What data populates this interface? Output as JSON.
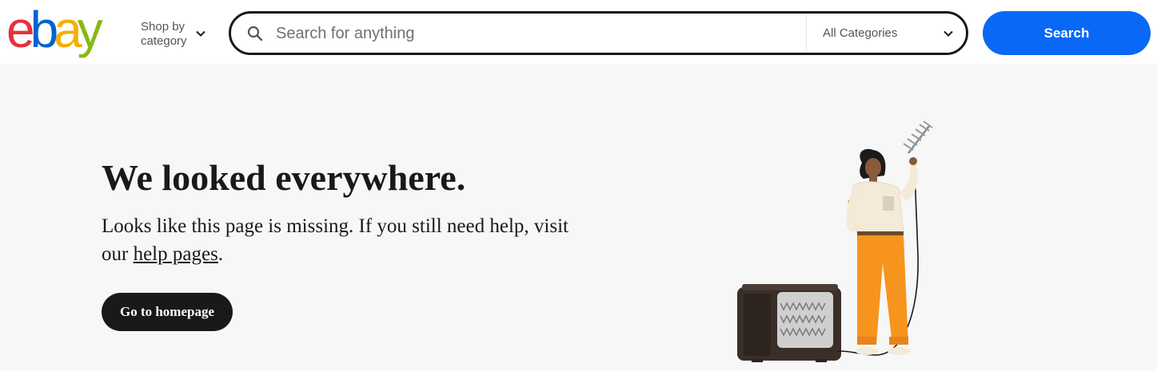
{
  "header": {
    "logo": {
      "letters": [
        "e",
        "b",
        "a",
        "y"
      ],
      "colors": [
        "#e53238",
        "#0064d2",
        "#f5af02",
        "#86b817"
      ]
    },
    "shop_by_category": "Shop by category",
    "search": {
      "placeholder": "Search for anything",
      "value": "",
      "category_selected": "All Categories",
      "button_label": "Search",
      "button_color": "#0968f6"
    }
  },
  "main": {
    "headline": "We looked everywhere.",
    "body_prefix": "Looks like this page is missing. If you still need help, visit our ",
    "help_link": "help pages",
    "body_suffix": ".",
    "homepage_button": "Go to homepage"
  },
  "illustration": {
    "subject": "person-with-antenna-and-tv",
    "pants_color": "#f7941d",
    "shirt_color": "#f3ead7"
  }
}
